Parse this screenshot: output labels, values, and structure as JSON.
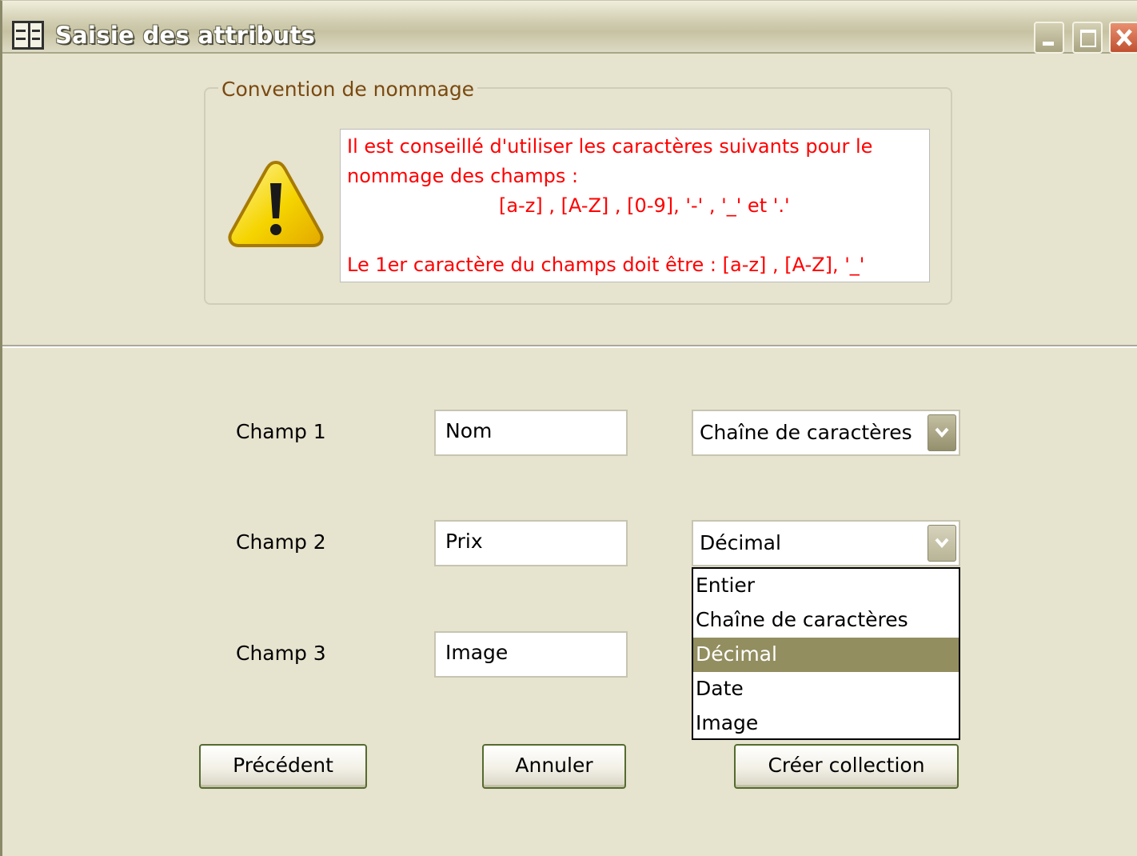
{
  "window": {
    "title": "Saisie des attributs",
    "controls": [
      "minimize",
      "maximize",
      "close"
    ]
  },
  "naming_convention": {
    "legend": "Convention de nommage",
    "icon": "warning-icon",
    "lines": [
      "Il est conseillé d'utiliser les caractères suivants pour le",
      "nommage des champs :",
      "[a-z] ,  [A-Z] ,  [0-9], '-' ,  '_' et '.'",
      "Le 1er caractère du champs doit être : [a-z] ,  [A-Z],  '_'"
    ],
    "text_color": "#ff0000"
  },
  "fields": [
    {
      "label": "Champ 1",
      "name": "Nom",
      "type": "Chaîne de caractères"
    },
    {
      "label": "Champ 2",
      "name": "Prix",
      "type": "Décimal"
    },
    {
      "label": "Champ 3",
      "name": "Image",
      "type": ""
    }
  ],
  "type_dropdown": {
    "options": [
      "Entier",
      "Chaîne de caractères",
      "Décimal",
      "Date",
      "Image"
    ],
    "selected": "Décimal",
    "highlight_color": "#938e60"
  },
  "buttons": {
    "previous": "Précédent",
    "cancel": "Annuler",
    "create": "Créer collection"
  }
}
